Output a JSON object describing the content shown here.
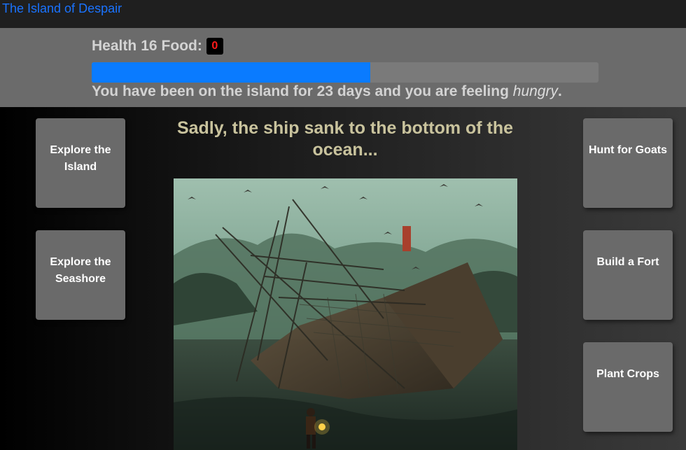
{
  "nav": {
    "title": "The Island of Despair"
  },
  "stats": {
    "health_label": "Health",
    "health": "16",
    "food_label": "Food:",
    "food": "0",
    "progress_fraction": 0.55,
    "days_text": "You have been on the island for 23 days and you are feeling ",
    "feeling": "hungry",
    "period": "."
  },
  "actions": {
    "explore_island": "Explore the Island",
    "explore_seashore": "Explore the Seashore",
    "hunt_goats": "Hunt for Goats",
    "build_fort": "Build a Fort",
    "plant_crops": "Plant Crops"
  },
  "message": "Sadly, the ship sank to the bottom of the ocean...",
  "colors": {
    "accent": "#0a7bff",
    "food_alert": "#ff1a1a",
    "message": "#c9c39d"
  }
}
